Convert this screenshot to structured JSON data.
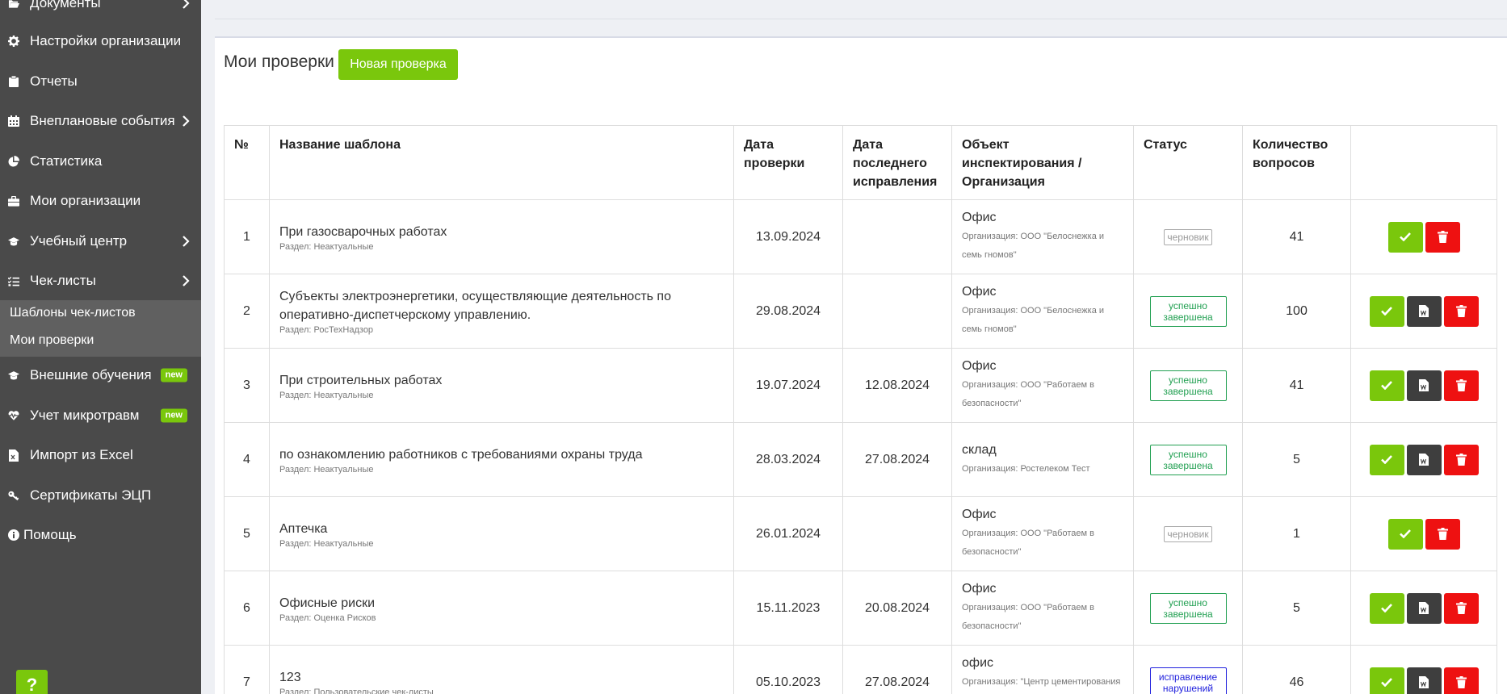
{
  "sidebar": {
    "items": [
      {
        "label": "Документы",
        "icon": "folder-open-icon",
        "chevron": true
      },
      {
        "label": "Настройки организации",
        "icon": "gear-icon",
        "chevron": false
      },
      {
        "label": "Отчеты",
        "icon": "clipboard-icon",
        "chevron": false
      },
      {
        "label": "Внеплановые события",
        "icon": "calendar-icon",
        "chevron": true
      },
      {
        "label": "Статистика",
        "icon": "pie-chart-icon",
        "chevron": false
      },
      {
        "label": "Мои организации",
        "icon": "briefcase-icon",
        "chevron": false
      },
      {
        "label": "Учебный центр",
        "icon": "graduation-cap-icon",
        "chevron": true
      },
      {
        "label": "Чек-листы",
        "icon": "list-check-icon",
        "chevron": true
      }
    ],
    "submenu": [
      "Шаблоны чек-листов",
      "Мои проверки"
    ],
    "items_after": [
      {
        "label": "Внешние обучения",
        "icon": "graduation-cap-icon",
        "badge": "new"
      },
      {
        "label": "Учет микротравм",
        "icon": "heartbeat-icon",
        "badge": "new"
      },
      {
        "label": "Импорт из Excel",
        "icon": "excel-file-icon",
        "badge": ""
      },
      {
        "label": "Сертификаты ЭЦП",
        "icon": "key-icon",
        "badge": ""
      },
      {
        "label": "Помощь",
        "icon": "info-circle-icon",
        "badge": ""
      }
    ],
    "help_label": "?"
  },
  "main": {
    "title": "Мои проверки",
    "new_button": "Новая проверка",
    "columns": [
      "№",
      "Название шаблона",
      "Дата проверки",
      "Дата последнего исправления",
      "Объект инспектирования / Организация",
      "Статус",
      "Количество вопросов",
      ""
    ],
    "rows": [
      {
        "num": "1",
        "name": "При газосварочных работах",
        "section": "Раздел: Неактуальные",
        "date": "13.09.2024",
        "fixed": "",
        "object": "Офис",
        "org": "Организация: ООО \"Белоснежка и семь гномов\"",
        "status": "черновик",
        "status_type": "draft",
        "qty": "41",
        "actions": [
          "ok",
          "del"
        ]
      },
      {
        "num": "2",
        "name": "Субъекты электроэнергетики, осуществляющие деятельность по оперативно-диспетчерскому управлению.",
        "section": "Раздел: РосТехНадзор",
        "date": "29.08.2024",
        "fixed": "",
        "object": "Офис",
        "org": "Организация: ООО \"Белоснежка и семь гномов\"",
        "status": "успешно завершена",
        "status_type": "done",
        "qty": "100",
        "actions": [
          "ok",
          "doc",
          "del"
        ]
      },
      {
        "num": "3",
        "name": "При строительных работах",
        "section": "Раздел: Неактуальные",
        "date": "19.07.2024",
        "fixed": "12.08.2024",
        "object": "Офис",
        "org": "Организация: ООО \"Работаем в безопасности\"",
        "status": "успешно завершена",
        "status_type": "done",
        "qty": "41",
        "actions": [
          "ok",
          "doc",
          "del"
        ]
      },
      {
        "num": "4",
        "name": "по ознакомлению работников с требованиями охраны труда",
        "section": "Раздел: Неактуальные",
        "date": "28.03.2024",
        "fixed": "27.08.2024",
        "object": "склад",
        "org": "Организация: Ростелеком Тест",
        "status": "успешно завершена",
        "status_type": "done",
        "qty": "5",
        "actions": [
          "ok",
          "doc",
          "del"
        ]
      },
      {
        "num": "5",
        "name": "Аптечка",
        "section": "Раздел: Неактуальные",
        "date": "26.01.2024",
        "fixed": "",
        "object": "Офис",
        "org": "Организация: ООО \"Работаем в безопасности\"",
        "status": "черновик",
        "status_type": "draft",
        "qty": "1",
        "actions": [
          "ok",
          "del"
        ]
      },
      {
        "num": "6",
        "name": "Офисные риски",
        "section": "Раздел: Оценка Рисков",
        "date": "15.11.2023",
        "fixed": "20.08.2024",
        "object": "Офис",
        "org": "Организация: ООО \"Работаем в безопасности\"",
        "status": "успешно завершена",
        "status_type": "done",
        "qty": "5",
        "actions": [
          "ok",
          "doc",
          "del"
        ]
      },
      {
        "num": "7",
        "name": "123",
        "section": "Раздел: Пользовательские чек-листы",
        "date": "05.10.2023",
        "fixed": "27.08.2024",
        "object": "офис",
        "org": "Организация: \"Центр цементирования скважин\"",
        "status": "исправление нарушений",
        "status_type": "fix",
        "qty": "46",
        "actions": [
          "ok",
          "doc",
          "del"
        ]
      }
    ]
  },
  "colors": {
    "sidebar": "#4a4a4a",
    "accent": "#7ac70c",
    "danger": "#ee1111",
    "dark": "#3e3e3e",
    "success": "#22a052",
    "fix": "#2222dd"
  }
}
